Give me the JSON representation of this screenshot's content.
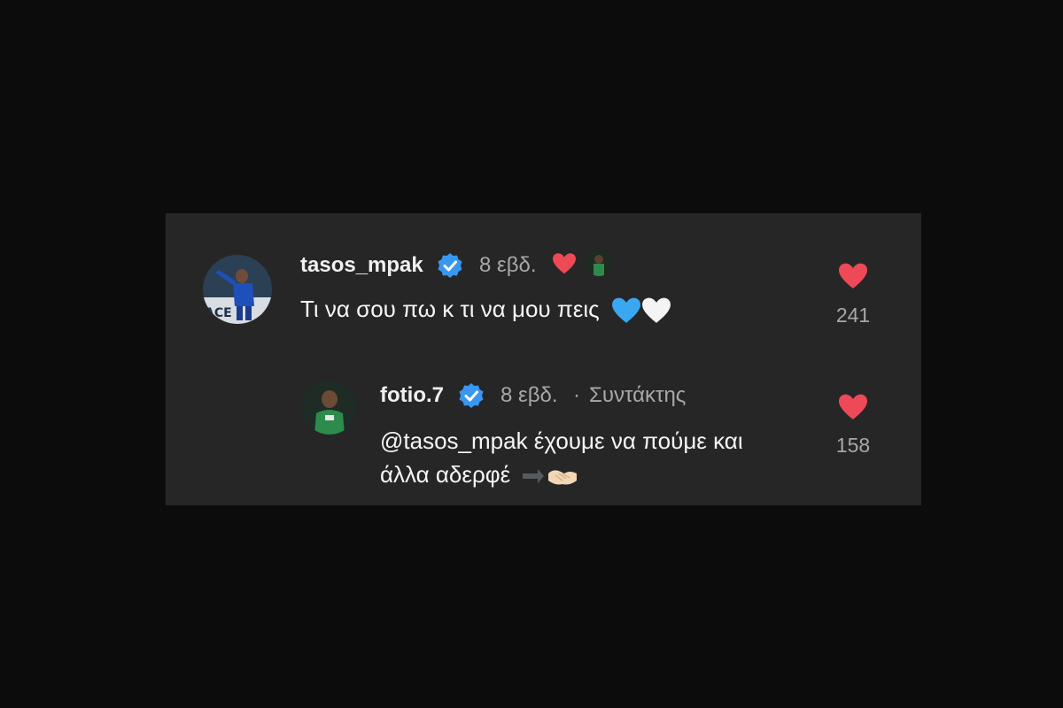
{
  "comments": [
    {
      "username": "tasos_mpak",
      "time": "8 εβδ.",
      "text": "Τι να σου πω κ τι να μου πεις",
      "emoji_icons": [
        "blue-heart-icon",
        "white-heart-icon"
      ],
      "likes": "241",
      "liked_by_author": true
    },
    {
      "username": "fotio.7",
      "time": "8 εβδ.",
      "separator": "·",
      "author_label": "Συντάκτης",
      "text_line1": "@tasos_mpak έχουμε να πούμε και",
      "text_line2": "άλλα αδερφέ",
      "emoji_icons": [
        "arrow-icon",
        "handshake-icon"
      ],
      "likes": "158"
    }
  ],
  "colors": {
    "background": "#0c0c0c",
    "panel": "#262626",
    "verified": "#3897f0",
    "heart": "#ed4956",
    "username": "#f0f0f0",
    "meta": "#a8a8a8"
  }
}
